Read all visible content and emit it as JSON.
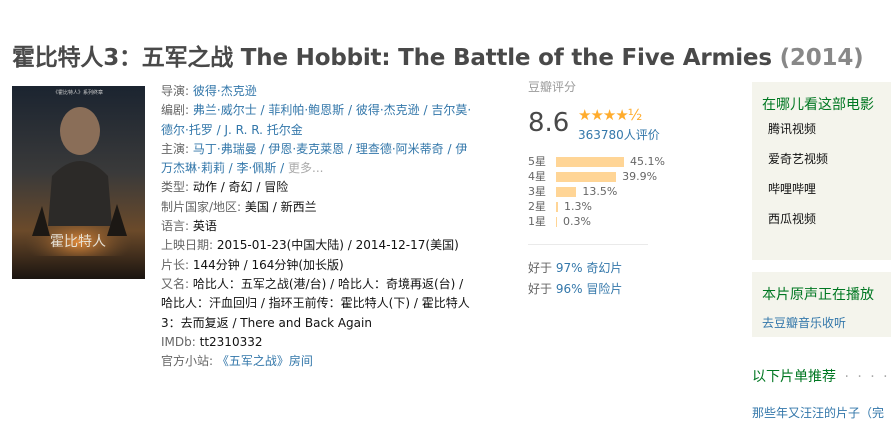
{
  "title": {
    "main": "霍比特人3：五军之战 The Hobbit: The Battle of the Five Armies",
    "year": "(2014)"
  },
  "poster": {
    "caption": "霍比特人",
    "top_text": "《霍比特人》系列终章"
  },
  "info": {
    "director_label": "导演:",
    "director": "彼得·杰克逊",
    "writer_label": "编剧:",
    "writer_line1": "弗兰·威尔士 / 菲利帕·鲍恩斯 / 彼得·杰克逊 / 吉尔莫·",
    "writer_line2": "德尔·托罗 / J. R. R. 托尔金",
    "cast_label": "主演:",
    "cast_line1": "马丁·弗瑞曼 / 伊恩·麦克莱恩 / 理查德·阿米蒂奇 / 伊",
    "cast_line2": "万杰琳·莉莉 / 李·佩斯 /",
    "cast_more": "更多...",
    "genre_label": "类型:",
    "genre": "动作 / 奇幻 / 冒险",
    "country_label": "制片国家/地区:",
    "country": "美国 / 新西兰",
    "lang_label": "语言:",
    "lang": "英语",
    "release_label": "上映日期:",
    "release": "2015-01-23(中国大陆) / 2014-12-17(美国)",
    "runtime_label": "片长:",
    "runtime": "144分钟 / 164分钟(加长版)",
    "aka_label": "又名:",
    "aka_line1": "哈比人：五军之战(港/台) / 哈比人：奇境再返(台) /",
    "aka_line2": "哈比人：汗血回归 / 指环王前传：霍比特人(下) / 霍比特人",
    "aka_line3": "3：去而复返 / There and Back Again",
    "imdb_label": "IMDb:",
    "imdb": "tt2310332",
    "site_label": "官方小站:",
    "site": "《五军之战》房间"
  },
  "rating": {
    "label": "豆瓣评分",
    "score": "8.6",
    "stars": "★★★★½",
    "votes": "363780人评价",
    "distribution": [
      {
        "label": "5星",
        "pct": "45.1%",
        "value": 45.1
      },
      {
        "label": "4星",
        "pct": "39.9%",
        "value": 39.9
      },
      {
        "label": "3星",
        "pct": "13.5%",
        "value": 13.5
      },
      {
        "label": "2星",
        "pct": "1.3%",
        "value": 1.3
      },
      {
        "label": "1星",
        "pct": "0.3%",
        "value": 0.3
      }
    ],
    "better1_pre": "好于",
    "better1_pct": "97%",
    "better1_genre": "奇幻片",
    "better2_pre": "好于",
    "better2_pct": "96%",
    "better2_genre": "冒险片"
  },
  "where": {
    "heading": "在哪儿看这部电影",
    "items": [
      "腾讯视频",
      "爱奇艺视频",
      "哔哩哔哩",
      "西瓜视频"
    ]
  },
  "soundtrack": {
    "heading": "本片原声正在播放",
    "link": "去豆瓣音乐收听"
  },
  "recommend": {
    "heading": "以下片单推荐",
    "dots": "· · · · ·",
    "cut_text": "那些年又汪汪的片子（完"
  },
  "colors": {
    "link": "#3377aa",
    "green": "#007722",
    "star": "#ffac2d",
    "bar": "#ffd596"
  }
}
